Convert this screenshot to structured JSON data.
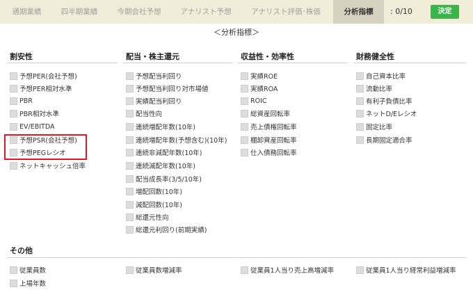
{
  "tabs": [
    {
      "label": "通期業績",
      "active": false
    },
    {
      "label": "四半期業績",
      "active": false
    },
    {
      "label": "今期会社予想",
      "active": false
    },
    {
      "label": "アナリスト予想",
      "active": false
    },
    {
      "label": "アナリスト評価･株価",
      "active": false
    },
    {
      "label": "分析指標",
      "active": true
    }
  ],
  "counter": ": 0/10",
  "confirm_label": "決定",
  "page_title": "＜分析指標＞",
  "sections": {
    "valuation": {
      "title": "割安性",
      "items": [
        "予想PER(会社予想)",
        "予想PER相対水準",
        "PBR",
        "PBR相対水準",
        "EV/EBITDA",
        "予想PSR(会社予想)",
        "予想PEGレシオ",
        "ネットキャッシュ倍率"
      ]
    },
    "dividend": {
      "title": "配当・株主還元",
      "items": [
        "予想配当利回り",
        "予想配当利回り対市場値",
        "実績配当利回り",
        "配当性向",
        "連続増配年数(10年)",
        "連続増配年数(予想含む)(10年)",
        "連続非減配年数(10年)",
        "連続減配年数(10年)",
        "配当成長率(3/5/10年)",
        "増配回数(10年)",
        "減配回数(10年)",
        "総還元性向",
        "総還元利回り(前期実績)"
      ]
    },
    "profitability": {
      "title": "収益性・効率性",
      "items": [
        "実績ROE",
        "実績ROA",
        "ROIC",
        "総資産回転率",
        "売上債権回転率",
        "棚卸資産回転率",
        "仕入債務回転率"
      ]
    },
    "financial": {
      "title": "財務健全性",
      "items": [
        "自己資本比率",
        "流動比率",
        "有利子負債比率",
        "ネットD/Eレシオ",
        "固定比率",
        "長期固定適合率"
      ]
    },
    "other": {
      "title": "その他",
      "items": [
        "従業員数",
        "従業員数増減率",
        "従業員1人当り売上高増減率",
        "従業員1人当り経常利益増減率",
        "上場年数"
      ]
    }
  }
}
